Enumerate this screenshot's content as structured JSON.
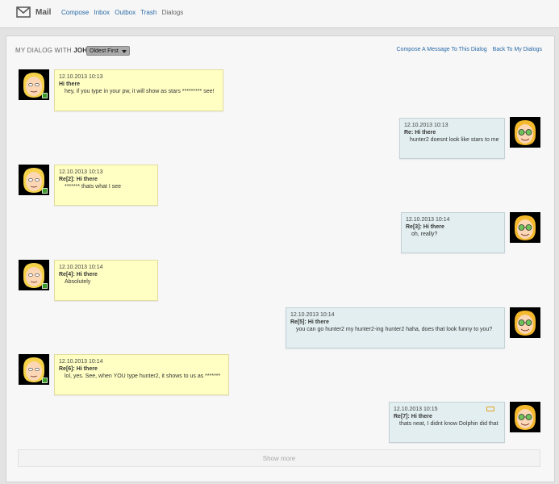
{
  "app": {
    "title": "Mail"
  },
  "nav": {
    "compose": "Compose",
    "inbox": "Inbox",
    "outbox": "Outbox",
    "trash": "Trash",
    "dialogs": "Dialogs"
  },
  "dialog": {
    "label": "My Dialog With",
    "partner": "John",
    "sort_value": "Oldest First",
    "compose_link": "Compose A Message To This Dialog",
    "back_link": "Back To My Dialogs"
  },
  "messages": [
    {
      "side": "them",
      "date": "12.10.2013 10:13",
      "subject": "Hi there",
      "body": "hey, if you type in your pw, it will show as stars ********* see!"
    },
    {
      "side": "me",
      "date": "12.10.2013 10:13",
      "subject": "Re: Hi there",
      "body": "hunter2 doesnt look like stars to me"
    },
    {
      "side": "them",
      "date": "12.10.2013 10:13",
      "subject": "Re[2]: Hi there",
      "body": "******* thats what I see"
    },
    {
      "side": "me",
      "date": "12.10.2013 10:14",
      "subject": "Re[3]: Hi there",
      "body": "oh, really?"
    },
    {
      "side": "them",
      "date": "12.10.2013 10:14",
      "subject": "Re[4]: Hi there",
      "body": "Absolutely"
    },
    {
      "side": "me",
      "date": "12.10.2013 10:14",
      "subject": "Re[5]: Hi there",
      "body": "you can go hunter2 my hunter2-ing hunter2 haha, does that look funny to you?"
    },
    {
      "side": "them",
      "date": "12.10.2013 10:14",
      "subject": "Re[6]: Hi there",
      "body": "lol, yes. See, when YOU type hunter2, it shows to us as *******"
    },
    {
      "side": "me",
      "date": "12.10.2013 10:15",
      "subject": "Re[7]: Hi there",
      "body": "thats neat, I didnt know Dolphin did that"
    }
  ],
  "show_more": "Show more",
  "colors": {
    "link": "#2a6aa8",
    "incoming_bg": "#ffffc4",
    "outgoing_bg": "#e2eef0"
  },
  "icons": {
    "mail": "envelope-icon",
    "online": "online-status-icon",
    "flag": "flag-icon"
  }
}
